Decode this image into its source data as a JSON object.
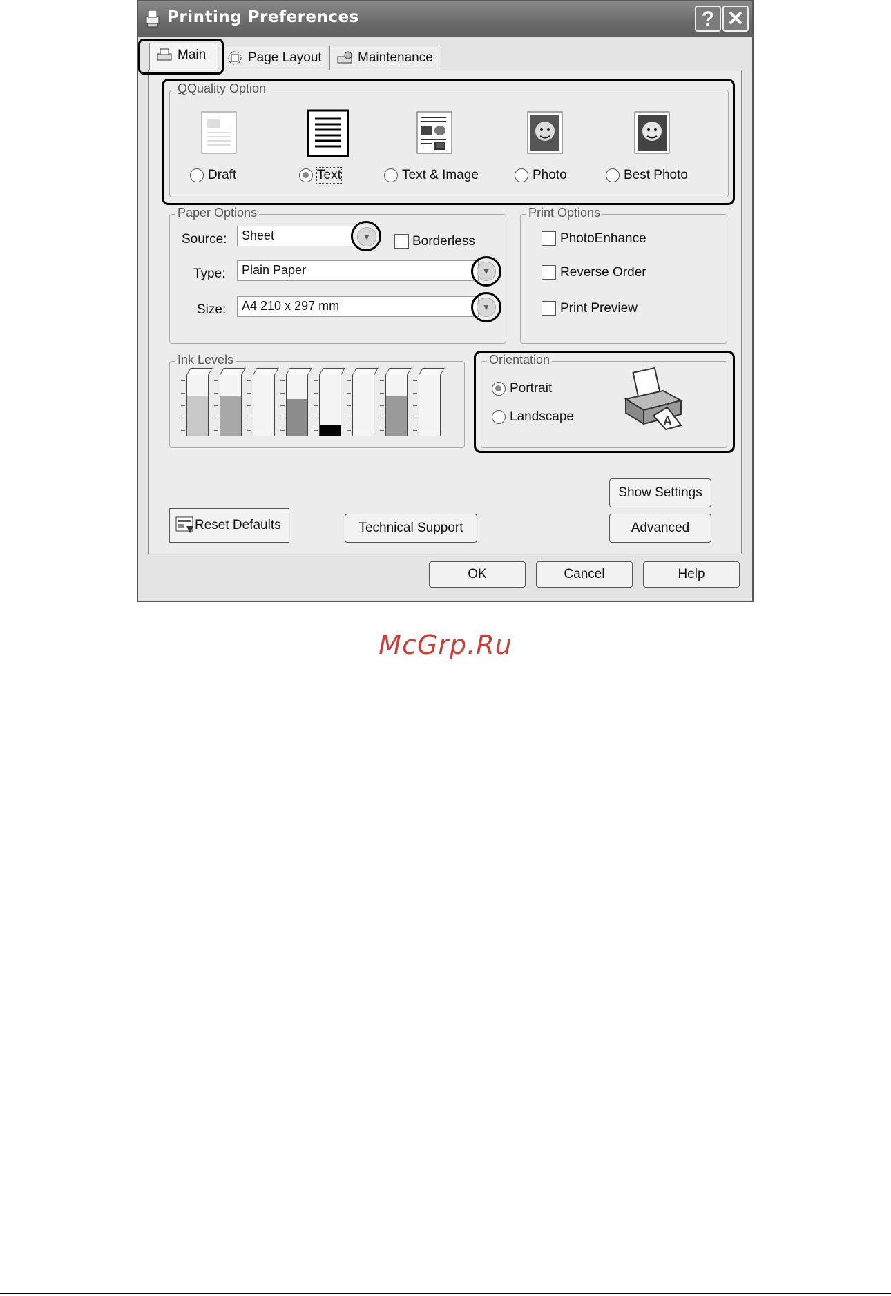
{
  "window": {
    "title": "Printing Preferences",
    "help_glyph": "?",
    "close_glyph": "✕"
  },
  "tabs": [
    {
      "label": "Main"
    },
    {
      "label": "Page Layout"
    },
    {
      "label": "Maintenance"
    }
  ],
  "quality": {
    "group_label": "Quality Option",
    "options": [
      {
        "label": "Draft",
        "selected": false
      },
      {
        "label": "Text",
        "selected": true
      },
      {
        "label": "Text & Image",
        "selected": false
      },
      {
        "label": "Photo",
        "selected": false
      },
      {
        "label": "Best Photo",
        "selected": false
      }
    ]
  },
  "paper": {
    "group_label": "Paper Options",
    "source_label": "Source:",
    "source_value": "Sheet",
    "type_label": "Type:",
    "type_value": "Plain Paper",
    "size_label": "Size:",
    "size_value": "A4 210 x 297 mm",
    "borderless_label": "Borderless",
    "borderless_checked": false
  },
  "print_options": {
    "group_label": "Print Options",
    "items": [
      {
        "label": "PhotoEnhance",
        "checked": false
      },
      {
        "label": "Reverse Order",
        "checked": false
      },
      {
        "label": "Print Preview",
        "checked": false
      }
    ]
  },
  "ink": {
    "group_label": "Ink Levels",
    "levels": [
      0.68,
      0.68,
      0.0,
      0.62,
      0.18,
      0.0,
      0.68,
      0.0
    ],
    "fill_colors": [
      "#c8c8c8",
      "#a8a8a8",
      "#f2f2f2",
      "#8c8c8c",
      "#000000",
      "#f2f2f2",
      "#9a9a9a",
      "#f2f2f2"
    ]
  },
  "orientation": {
    "group_label": "Orientation",
    "portrait_label": "Portrait",
    "portrait_selected": true,
    "landscape_label": "Landscape",
    "landscape_selected": false
  },
  "buttons": {
    "show_settings": "Show Settings",
    "advanced": "Advanced",
    "reset_defaults": "Reset Defaults",
    "technical_support": "Technical Support",
    "ok": "OK",
    "cancel": "Cancel",
    "help": "Help"
  },
  "watermark": "McGrp.Ru"
}
